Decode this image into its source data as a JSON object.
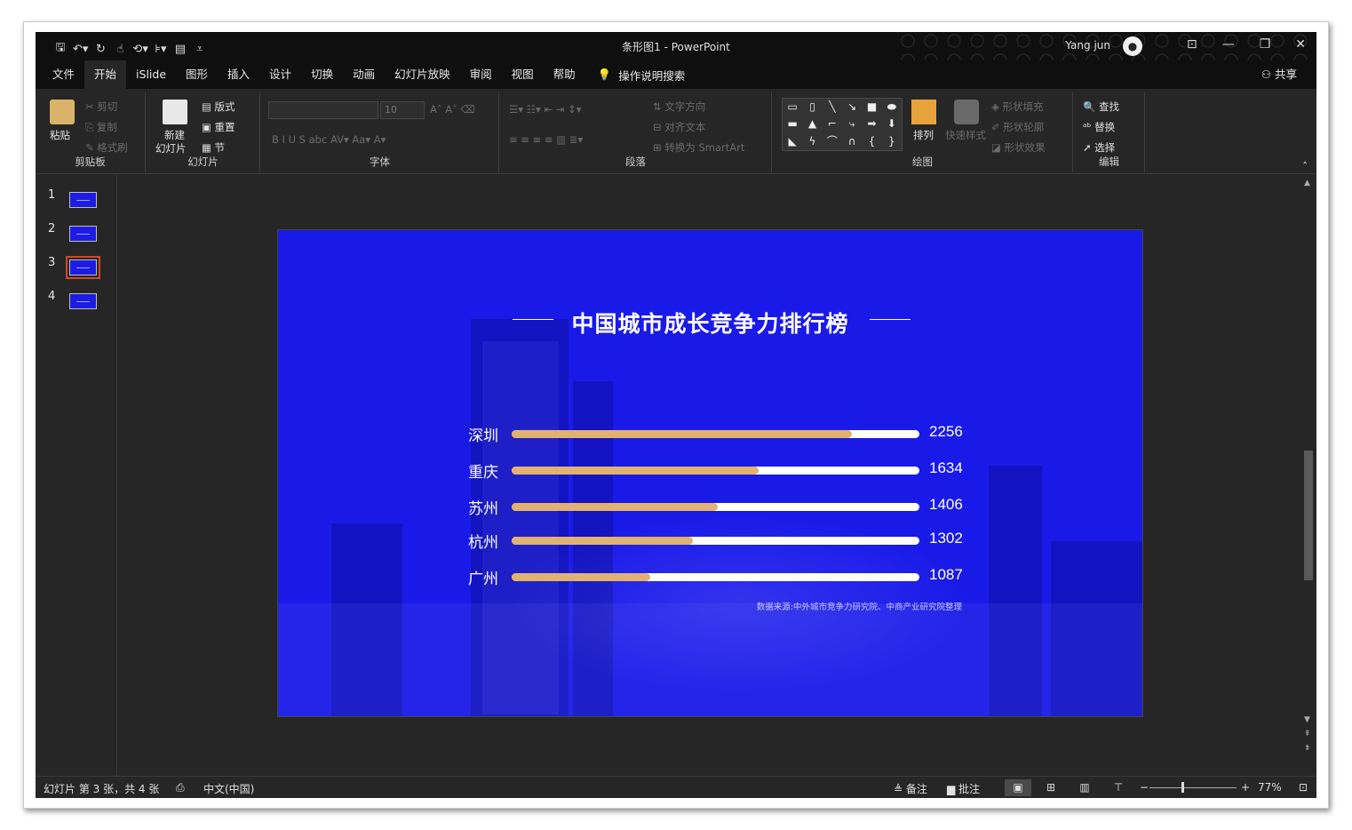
{
  "window": {
    "doc_title": "条形图1 - PowerPoint",
    "user_name": "Yang jun",
    "share_label": "共享"
  },
  "qat_icons": [
    "save-icon",
    "undo-icon",
    "redo-icon",
    "touch-mode-icon",
    "present-icon",
    "format-painter-icon",
    "layout-icon",
    "customize-icon"
  ],
  "tabs": [
    {
      "label": "文件"
    },
    {
      "label": "开始"
    },
    {
      "label": "iSlide"
    },
    {
      "label": "图形"
    },
    {
      "label": "插入"
    },
    {
      "label": "设计"
    },
    {
      "label": "切换"
    },
    {
      "label": "动画"
    },
    {
      "label": "幻灯片放映"
    },
    {
      "label": "审阅"
    },
    {
      "label": "视图"
    },
    {
      "label": "帮助"
    }
  ],
  "tell_me": "操作说明搜索",
  "ribbon": {
    "clipboard": {
      "paste": "粘贴",
      "cut": "剪切",
      "copy": "复制",
      "painter": "格式刷",
      "label": "剪贴板"
    },
    "slides": {
      "new": "新建",
      "new2": "幻灯片",
      "layout": "版式",
      "reset": "重置",
      "section": "节",
      "label": "幻灯片"
    },
    "font": {
      "size": "10",
      "label": "字体"
    },
    "paragraph": {
      "direction": "文字方向",
      "align": "对齐文本",
      "smartart": "转换为 SmartArt",
      "label": "段落"
    },
    "drawing": {
      "arrange": "排列",
      "quick": "快速样式",
      "fill": "形状填充",
      "outline": "形状轮廓",
      "effect": "形状效果",
      "label": "绘图"
    },
    "editing": {
      "find": "查找",
      "replace": "替换",
      "select": "选择",
      "label": "编辑"
    }
  },
  "thumbs": [
    {
      "num": "1"
    },
    {
      "num": "2"
    },
    {
      "num": "3"
    },
    {
      "num": "4"
    }
  ],
  "slide": {
    "title": "中国城市成长竞争力排行榜",
    "source": "数据来源:中外城市竞争力研究院、中商产业研究院整理"
  },
  "chart_data": {
    "type": "bar",
    "title": "中国城市成长竞争力排行榜",
    "categories": [
      "深圳",
      "重庆",
      "苏州",
      "杭州",
      "广州"
    ],
    "values": [
      2256,
      1634,
      1406,
      1302,
      1087
    ],
    "value_labels": [
      "2256",
      "1634",
      "1406",
      "1302",
      "1087"
    ],
    "fill_fractions": [
      0.835,
      0.605,
      0.505,
      0.445,
      0.34
    ],
    "colors": {
      "fill": "#e2b270",
      "track": "#ffffff",
      "background": "#1a1ae8"
    }
  },
  "status": {
    "slide_info": "幻灯片 第 3 张，共 4 张",
    "language": "中文(中国)",
    "notes": "备注",
    "comments": "批注",
    "zoom": "77%"
  }
}
